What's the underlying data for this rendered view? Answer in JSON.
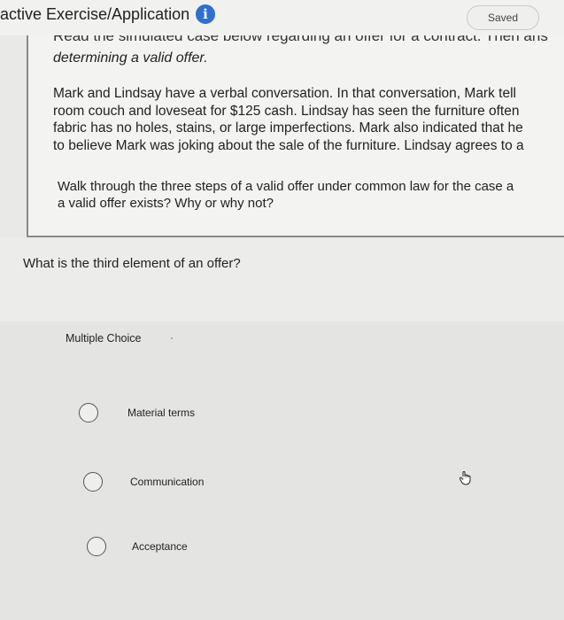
{
  "header": {
    "title": "active Exercise/Application",
    "info_icon": "info-icon",
    "saved_label": "Saved"
  },
  "case": {
    "cut_line": "Read the simulated case below regarding an offer for a contract. Then ans",
    "lead": "determining a valid offer.",
    "scenario_lines": [
      "Mark and Lindsay have a verbal conversation. In that conversation, Mark tell",
      "room couch and loveseat for $125 cash. Lindsay has seen the furniture often",
      "fabric has no holes, stains, or large imperfections. Mark also indicated that he",
      "to believe Mark was joking about the sale of the furniture. Lindsay agrees to a"
    ],
    "prompt_lines": [
      "Walk through the three steps of a valid offer under common law for the case a",
      "a valid offer exists? Why or why not?"
    ]
  },
  "question": {
    "text": "What is the third element of an offer?"
  },
  "choices": {
    "label": "Multiple Choice",
    "options": [
      {
        "label": "Material terms"
      },
      {
        "label": "Communication"
      },
      {
        "label": "Acceptance"
      }
    ]
  },
  "colors": {
    "accent": "#2e6fd0"
  }
}
